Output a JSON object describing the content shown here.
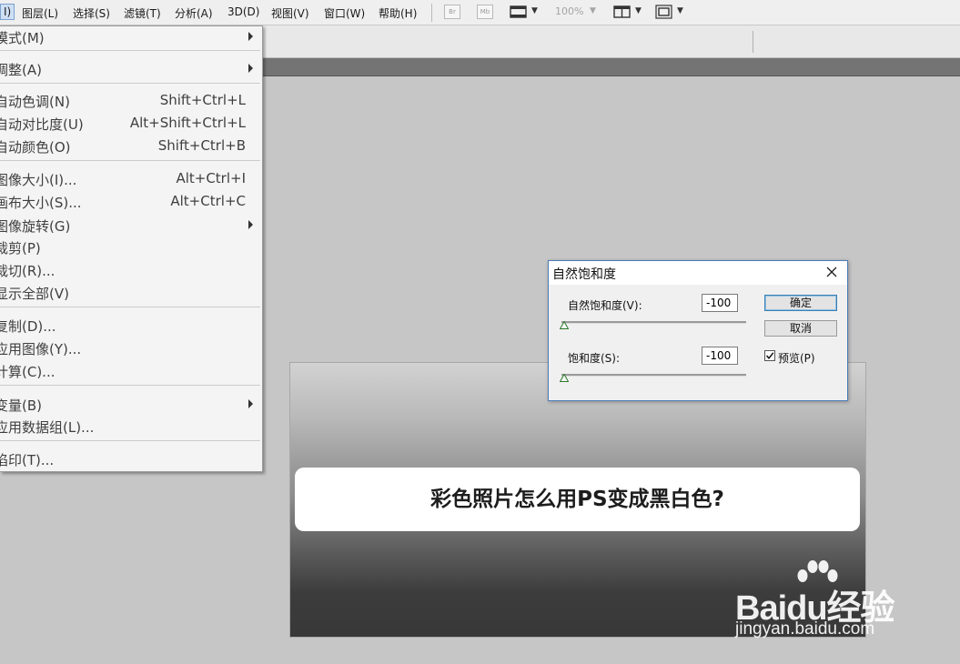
{
  "menubar": {
    "image_label": "I)",
    "items": [
      "图层(L)",
      "选择(S)",
      "滤镜(T)",
      "分析(A)",
      "3D(D)",
      "视图(V)",
      "窗口(W)",
      "帮助(H)"
    ],
    "tools": {
      "br": "Br",
      "mb": "Mb",
      "zoom": "100%"
    }
  },
  "dropdown": {
    "items": [
      {
        "label": "模式(M)",
        "shortcut": "",
        "submenu": true
      },
      {
        "label": "调整(A)",
        "shortcut": "",
        "submenu": true
      },
      {
        "label": "自动色调(N)",
        "shortcut": "Shift+Ctrl+L"
      },
      {
        "label": "自动对比度(U)",
        "shortcut": "Alt+Shift+Ctrl+L"
      },
      {
        "label": "自动颜色(O)",
        "shortcut": "Shift+Ctrl+B"
      },
      {
        "label": "图像大小(I)...",
        "shortcut": "Alt+Ctrl+I"
      },
      {
        "label": "画布大小(S)...",
        "shortcut": "Alt+Ctrl+C"
      },
      {
        "label": "图像旋转(G)",
        "shortcut": "",
        "submenu": true
      },
      {
        "label": "裁剪(P)",
        "shortcut": ""
      },
      {
        "label": "裁切(R)...",
        "shortcut": ""
      },
      {
        "label": "显示全部(V)",
        "shortcut": ""
      },
      {
        "label": "复制(D)...",
        "shortcut": ""
      },
      {
        "label": "应用图像(Y)...",
        "shortcut": ""
      },
      {
        "label": "计算(C)...",
        "shortcut": ""
      },
      {
        "label": "变量(B)",
        "shortcut": "",
        "submenu": true
      },
      {
        "label": "应用数据组(L)...",
        "shortcut": ""
      },
      {
        "label": "陷印(T)...",
        "shortcut": ""
      }
    ]
  },
  "canvas": {
    "banner_text": "彩色照片怎么用PS变成黑白色?"
  },
  "dialog": {
    "title": "自然饱和度",
    "vibrance_label": "自然饱和度(V):",
    "vibrance_value": "-100",
    "saturation_label": "饱和度(S):",
    "saturation_value": "-100",
    "ok_label": "确定",
    "cancel_label": "取消",
    "preview_label": "预览(P)",
    "preview_checked": true,
    "vibrance_slider_level": 0,
    "saturation_slider_level": 0
  },
  "watermark": {
    "brand": "Baidu经验",
    "url": "jingyan.baidu.com"
  },
  "colors": {
    "workspace": "#c6c6c6",
    "menu_bg": "#f4f4f4",
    "dialog_border": "#4c7cb7",
    "ok_border": "#3c7fb1"
  }
}
